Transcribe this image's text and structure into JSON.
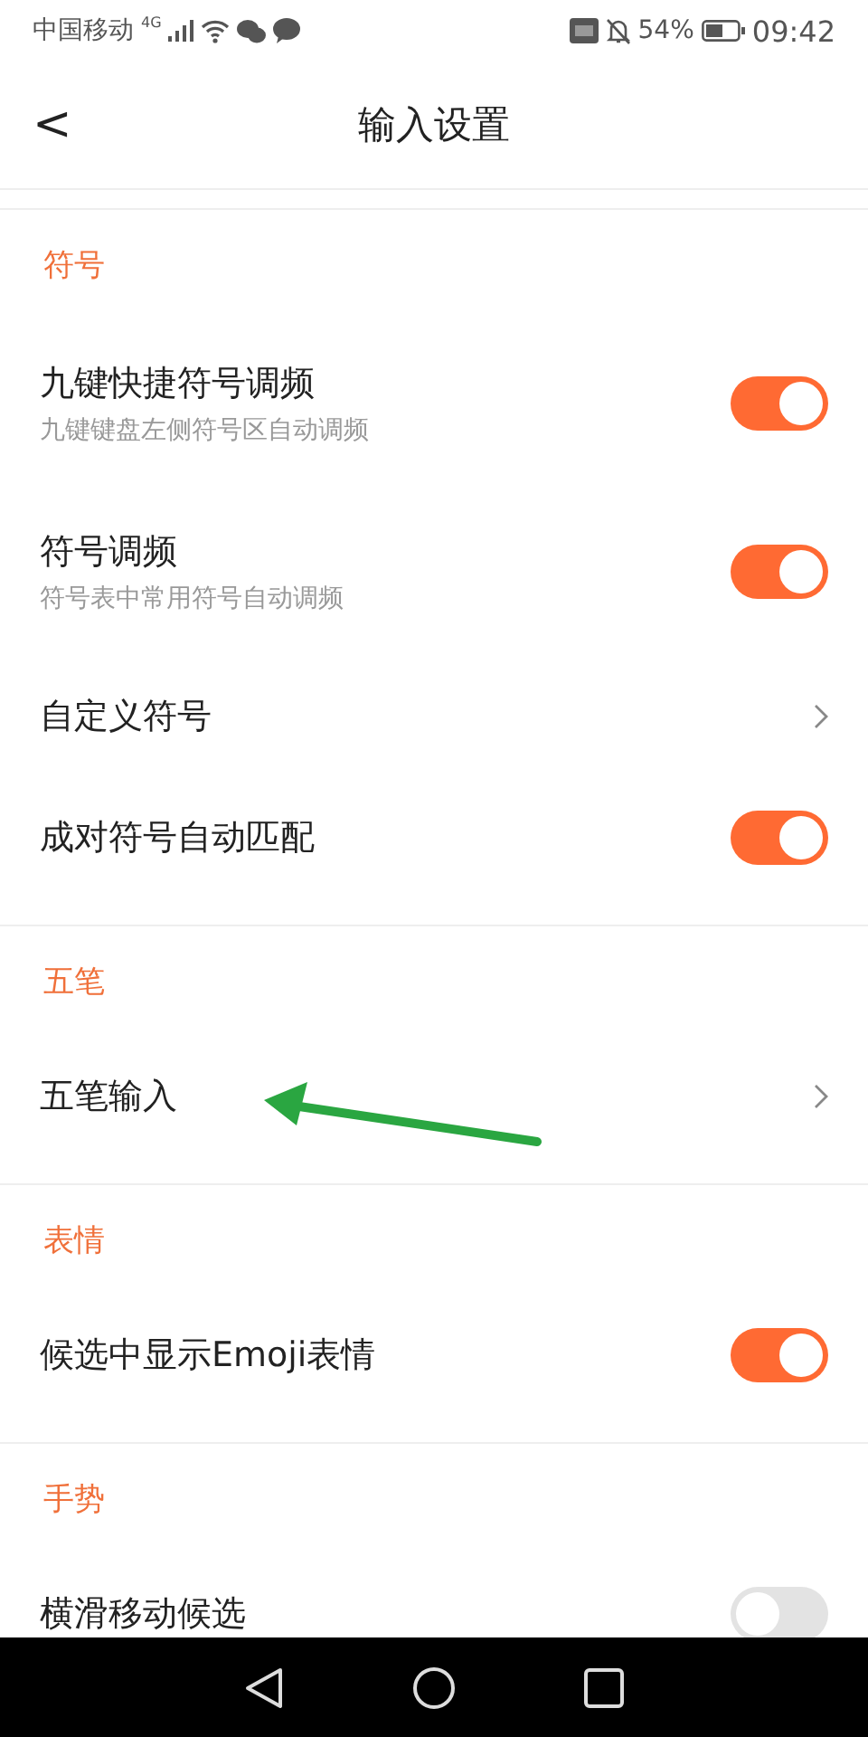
{
  "status_bar": {
    "carrier": "中国移动",
    "network": "4G",
    "battery": "54%",
    "time": "09:42"
  },
  "header": {
    "back": "<",
    "title": "输入设置"
  },
  "sections": [
    {
      "title": "符号",
      "items": [
        {
          "kind": "toggle",
          "label": "九键快捷符号调频",
          "description": "九键键盘左侧符号区自动调频",
          "on": true
        },
        {
          "kind": "toggle",
          "label": "符号调频",
          "description": "符号表中常用符号自动调频",
          "on": true
        },
        {
          "kind": "link",
          "label": "自定义符号"
        },
        {
          "kind": "toggle",
          "label": "成对符号自动匹配",
          "on": true
        }
      ]
    },
    {
      "title": "五笔",
      "items": [
        {
          "kind": "link",
          "label": "五笔输入"
        }
      ]
    },
    {
      "title": "表情",
      "items": [
        {
          "kind": "toggle",
          "label": "候选中显示Emoji表情",
          "on": true
        }
      ]
    },
    {
      "title": "手势",
      "items": [
        {
          "kind": "toggle",
          "label": "横滑移动候选",
          "on": false
        }
      ]
    }
  ]
}
